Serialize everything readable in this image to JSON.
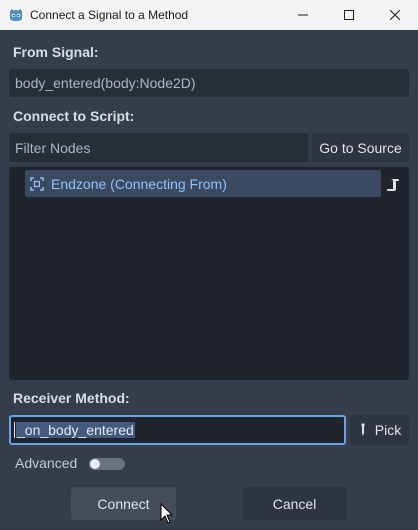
{
  "window": {
    "title": "Connect a Signal to a Method"
  },
  "icons": {
    "app": "godot-icon",
    "minimize": "minimize-icon",
    "maximize": "maximize-icon",
    "close": "close-icon",
    "node": "area2d-node-icon",
    "script": "script-icon",
    "pick": "pipette-icon",
    "cursor": "mouse-cursor-icon"
  },
  "from_signal": {
    "label": "From Signal:",
    "value": "body_entered(body:Node2D)"
  },
  "connect_to_script": {
    "label": "Connect to Script:",
    "filter_placeholder": "Filter Nodes",
    "go_to_source_label": "Go to Source",
    "tree": [
      {
        "label": "Endzone (Connecting From)",
        "selected": true
      }
    ]
  },
  "receiver_method": {
    "label": "Receiver Method:",
    "value": "_on_body_entered",
    "pick_label": "Pick"
  },
  "advanced": {
    "label": "Advanced",
    "enabled": false
  },
  "actions": {
    "connect_label": "Connect",
    "cancel_label": "Cancel"
  },
  "colors": {
    "background": "#363d4a",
    "accent": "#6aa6e6",
    "selected_row": "#3b4a60",
    "node_text": "#8fc2ff"
  }
}
